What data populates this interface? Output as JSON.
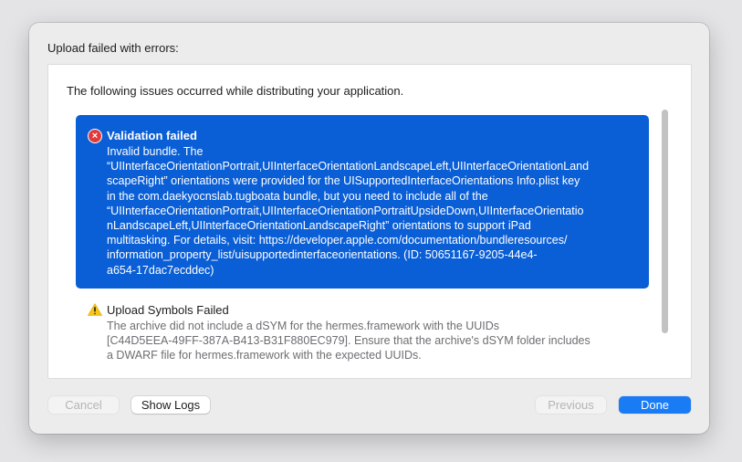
{
  "dialog": {
    "title": "Upload failed with errors:",
    "intro": "The following issues occurred while distributing your application."
  },
  "issues": [
    {
      "title": "Validation failed",
      "icon": "error-icon",
      "lines": [
        "Invalid bundle. The",
        "“UIInterfaceOrientationPortrait,UIInterfaceOrientationLandscapeLeft,UIInterfaceOrientationLand",
        "scapeRight” orientations were provided for the UISupportedInterfaceOrientations Info.plist key",
        "in the com.daekyocnslab.tugboata bundle, but you need to include all of the",
        "“UIInterfaceOrientationPortrait,UIInterfaceOrientationPortraitUpsideDown,UIInterfaceOrientatio",
        "nLandscapeLeft,UIInterfaceOrientationLandscapeRight” orientations to support iPad",
        "multitasking. For details, visit: https://developer.apple.com/documentation/bundleresources/",
        "information_property_list/uisupportedinterfaceorientations. (ID: 50651167-9205-44e4-",
        "a654-17dac7ecddec)"
      ]
    },
    {
      "title": "Upload Symbols Failed",
      "icon": "warning-icon",
      "lines": [
        "The archive did not include a dSYM for the hermes.framework with the UUIDs",
        "[C44D5EEA-49FF-387A-B413-B31F880EC979]. Ensure that the archive's dSYM folder includes",
        "a DWARF file for hermes.framework with the expected UUIDs."
      ]
    }
  ],
  "buttons": {
    "cancel": "Cancel",
    "show_logs": "Show Logs",
    "previous": "Previous",
    "done": "Done"
  },
  "colors": {
    "accent": "#1a7cf5",
    "selection": "#0a5fd6",
    "error": "#e23a3a",
    "warning": "#f5c518"
  }
}
